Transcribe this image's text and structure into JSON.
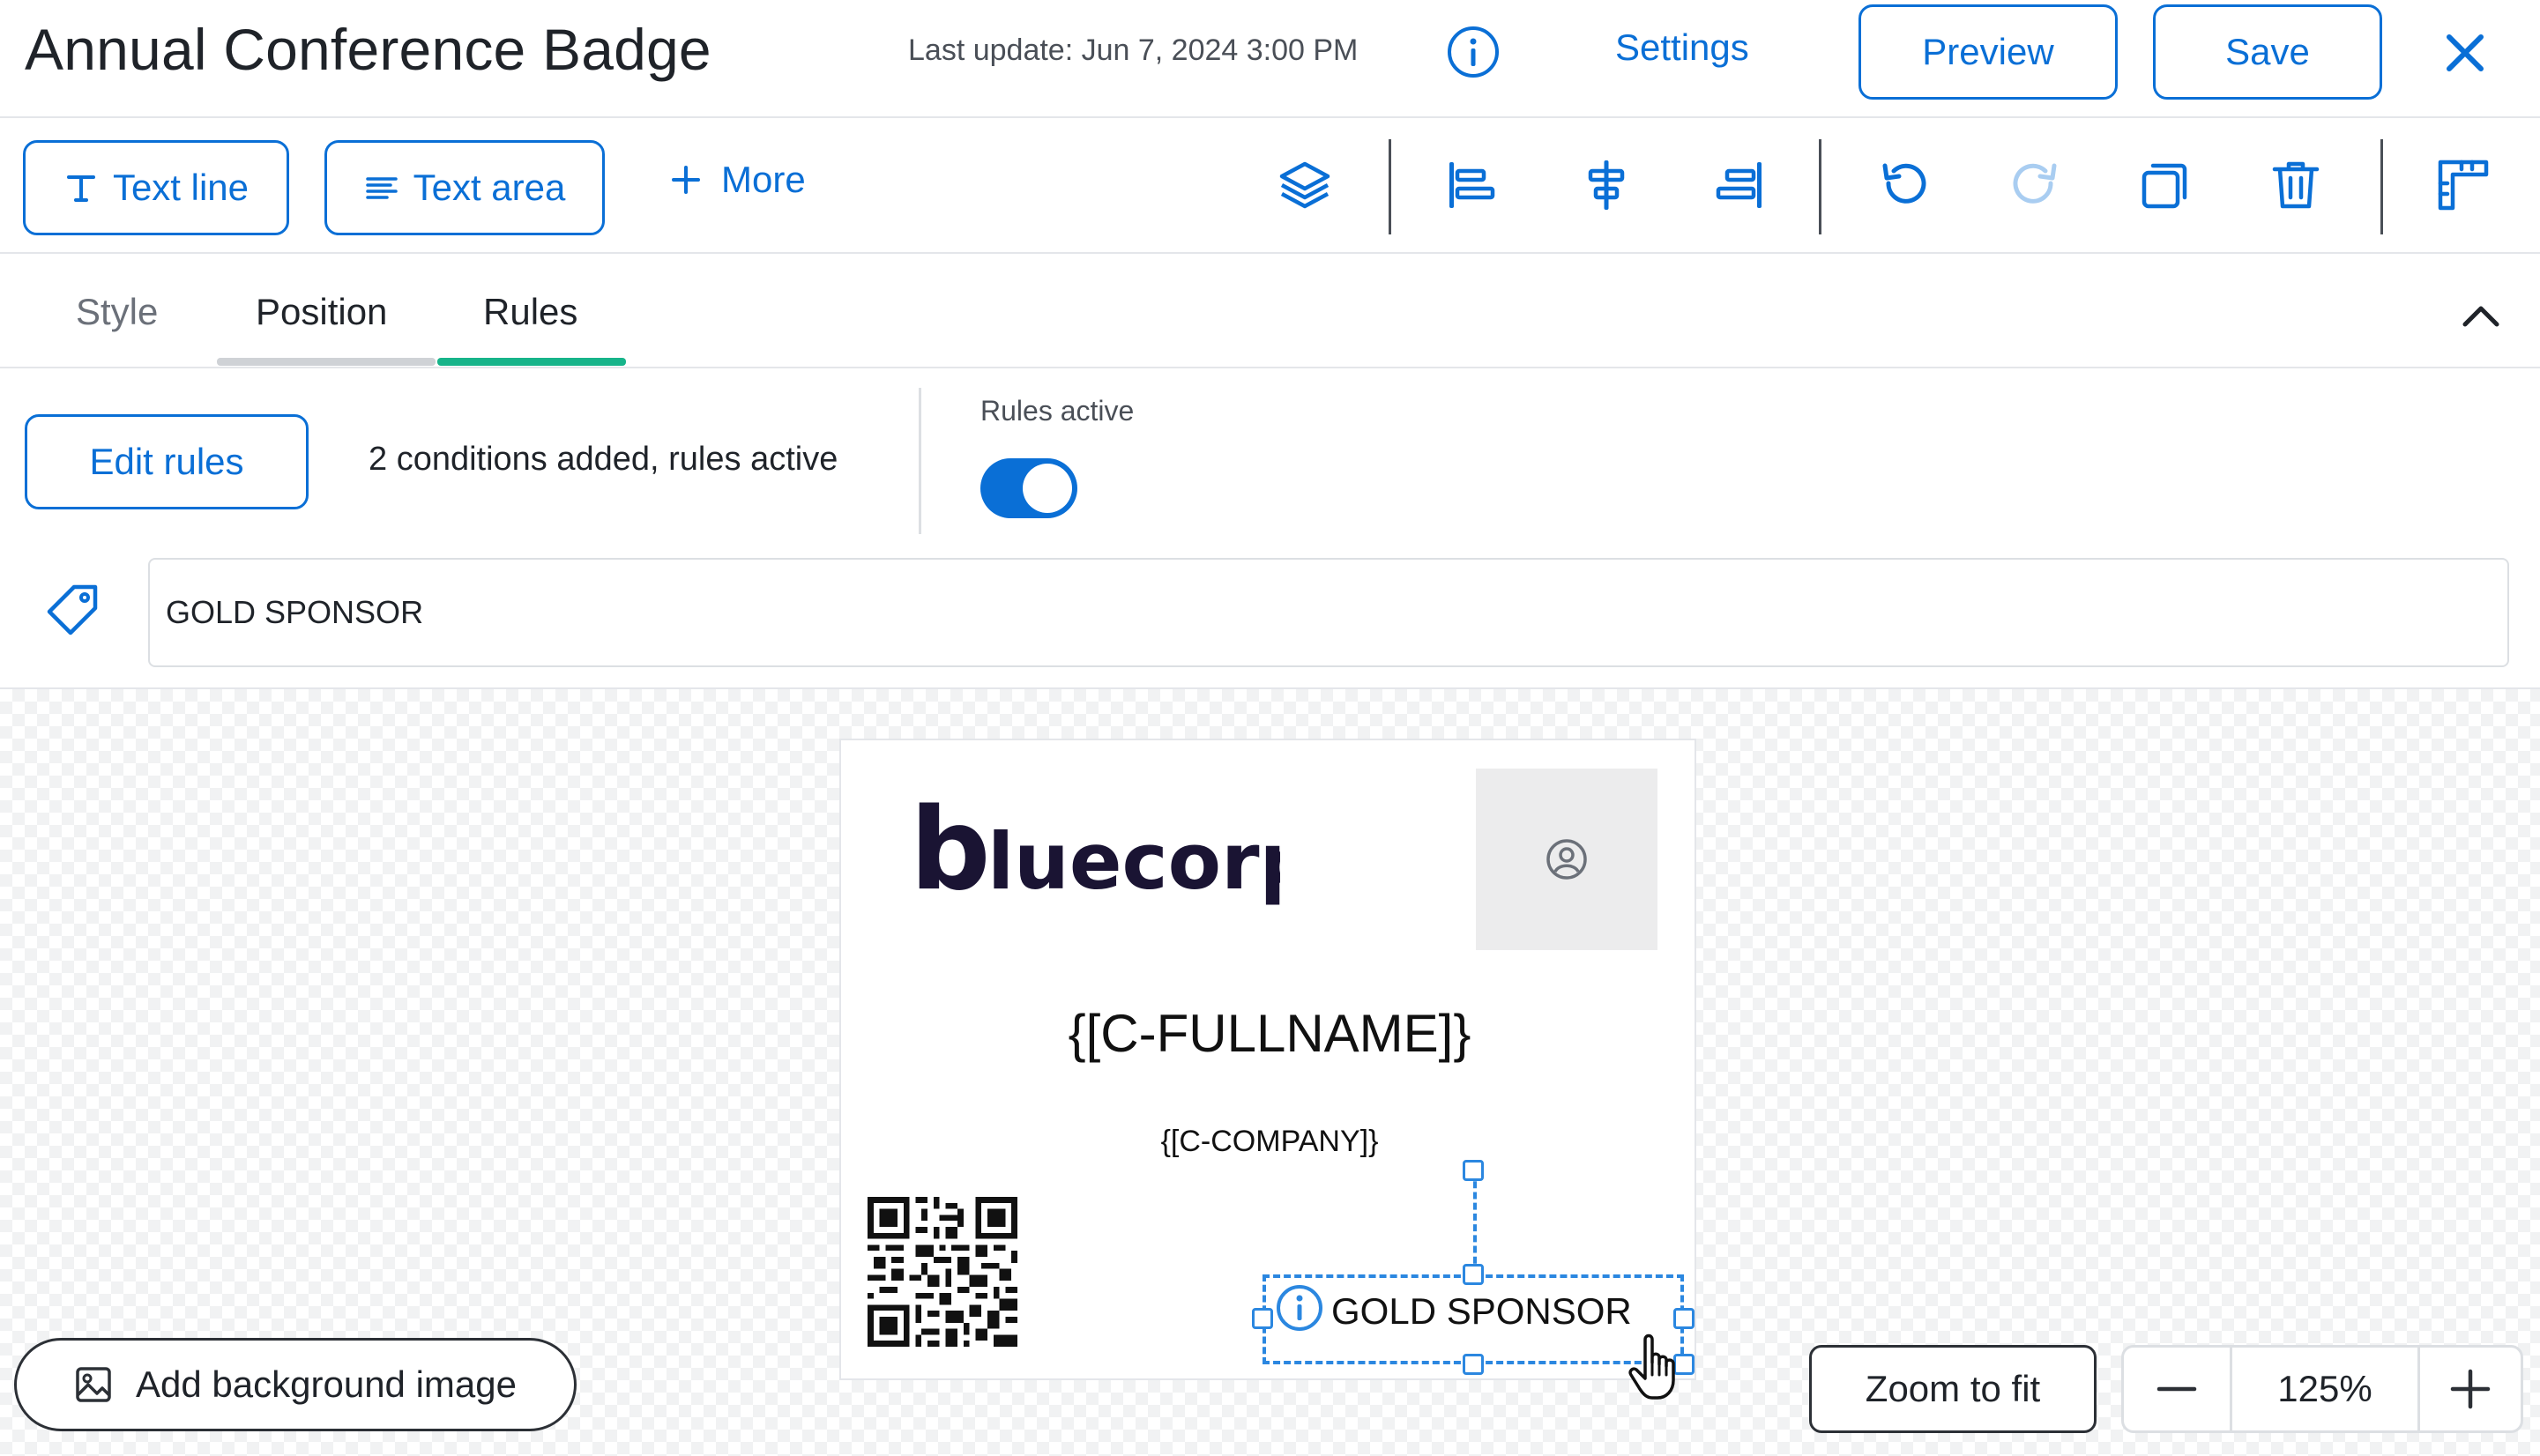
{
  "header": {
    "title": "Annual Conference Badge",
    "last_update": "Last update: Jun 7, 2024 3:00 PM",
    "settings_label": "Settings",
    "preview_label": "Preview",
    "save_label": "Save"
  },
  "toolbar": {
    "text_line_label": "Text line",
    "text_area_label": "Text area",
    "more_label": "More",
    "icons": [
      "layers-icon",
      "align-left-icon",
      "align-center-icon",
      "align-right-icon",
      "undo-icon",
      "redo-icon",
      "duplicate-icon",
      "delete-icon",
      "ruler-icon"
    ]
  },
  "tabs": [
    {
      "label": "Style",
      "active": false
    },
    {
      "label": "Position",
      "active": false
    },
    {
      "label": "Rules",
      "active": true
    }
  ],
  "rules": {
    "edit_label": "Edit rules",
    "status_text": "2 conditions added, rules active",
    "toggle_label": "Rules active",
    "toggle_on": true
  },
  "text_field": {
    "value": "GOLD SPONSOR"
  },
  "badge": {
    "logo_text": "bluecorp",
    "fullname_placeholder": "{[C-FULLNAME]}",
    "company_placeholder": "{[C-COMPANY]}",
    "sponsor_text": "GOLD SPONSOR"
  },
  "canvas_controls": {
    "add_background_label": "Add background image",
    "zoom_fit_label": "Zoom to fit",
    "zoom_level": "125%"
  },
  "colors": {
    "accent": "#0a6fd6",
    "tab_active": "#17b48a",
    "selection": "#2b87e0"
  }
}
